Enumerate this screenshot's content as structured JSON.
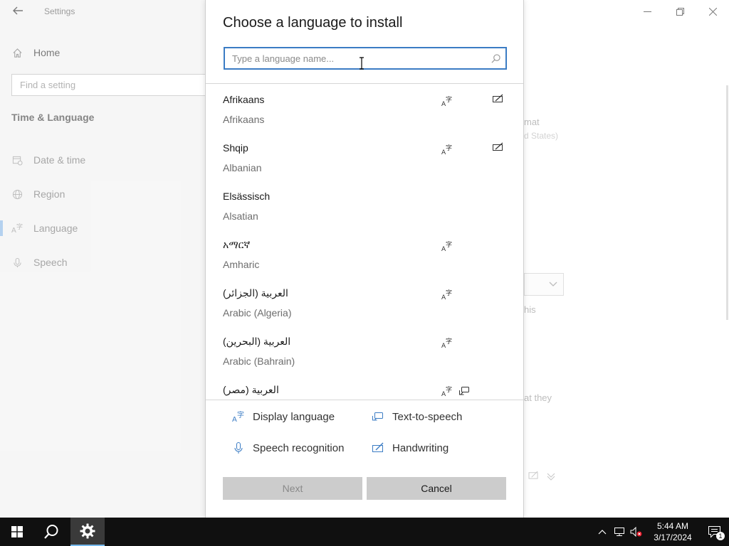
{
  "settings": {
    "app_title": "Settings",
    "home_label": "Home",
    "search_placeholder": "Find a setting",
    "category": "Time & Language",
    "nav": [
      {
        "label": "Date & time",
        "icon": "calendar-clock-icon"
      },
      {
        "label": "Region",
        "icon": "globe-icon"
      },
      {
        "label": "Language",
        "icon": "language-icon",
        "selected": true
      },
      {
        "label": "Speech",
        "icon": "microphone-icon"
      }
    ],
    "background_fragments": {
      "format": "mat",
      "format_sub": "d States)",
      "this": "his",
      "at_they": "at they"
    }
  },
  "dialog": {
    "title": "Choose a language to install",
    "search_placeholder": "Type a language name...",
    "search_value": "",
    "languages": [
      {
        "native": "Afrikaans",
        "english": "Afrikaans",
        "display": true,
        "tts": false,
        "handwriting": true
      },
      {
        "native": "Shqip",
        "english": "Albanian",
        "display": true,
        "tts": false,
        "handwriting": true
      },
      {
        "native": "Elsässisch",
        "english": "Alsatian",
        "display": false,
        "tts": false,
        "handwriting": false
      },
      {
        "native": "አማርኛ",
        "english": "Amharic",
        "display": true,
        "tts": false,
        "handwriting": false
      },
      {
        "native": "العربية (الجزائر)",
        "english": "Arabic (Algeria)",
        "display": true,
        "tts": false,
        "handwriting": false
      },
      {
        "native": "العربية (البحرين)",
        "english": "Arabic (Bahrain)",
        "display": true,
        "tts": false,
        "handwriting": false
      },
      {
        "native": "العربية (مصر)",
        "english": "",
        "display": true,
        "tts": true,
        "handwriting": false
      }
    ],
    "legend": {
      "display_language": "Display language",
      "text_to_speech": "Text-to-speech",
      "speech_recognition": "Speech recognition",
      "handwriting": "Handwriting"
    },
    "buttons": {
      "next": "Next",
      "cancel": "Cancel"
    }
  },
  "taskbar": {
    "time": "5:44 AM",
    "date": "3/17/2024",
    "notification_count": "1"
  },
  "colors": {
    "accent": "#3b7cc4",
    "taskbar": "#101010",
    "button_bg": "#cccccc"
  }
}
